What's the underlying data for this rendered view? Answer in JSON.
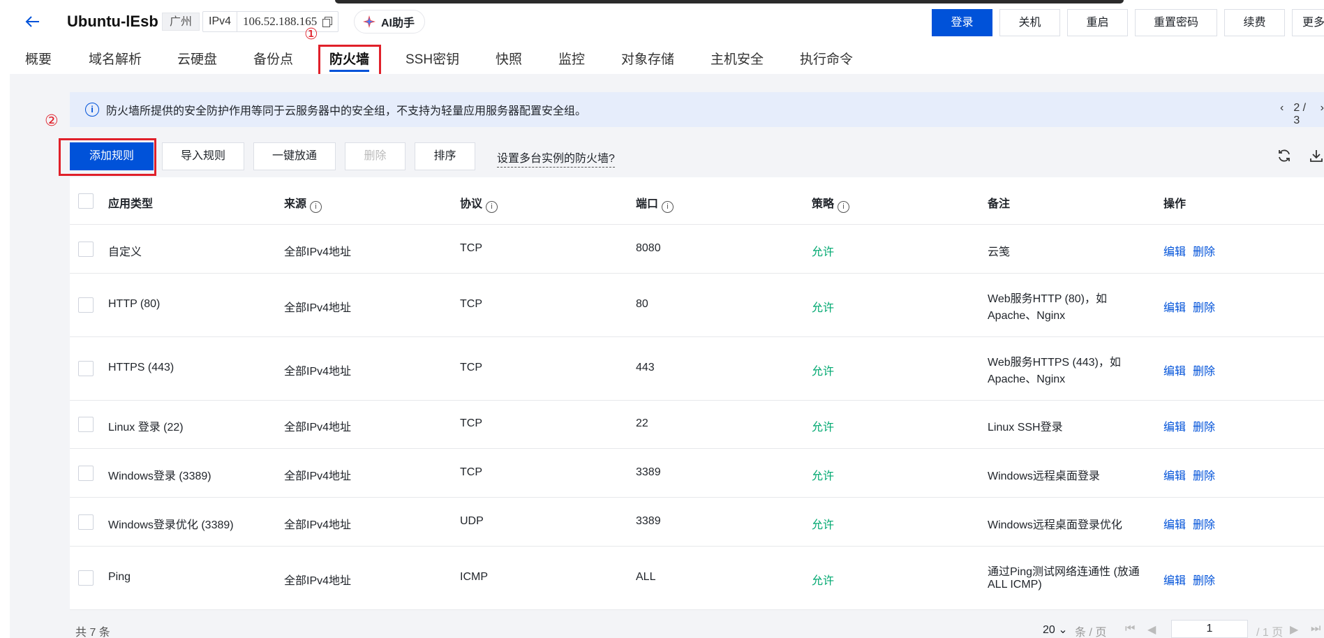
{
  "header": {
    "instance_name": "Ubuntu-lEsb",
    "region": "广州",
    "ip_label": "IPv4",
    "ip_value": "106.52.188.165",
    "ai_label": "AI助手",
    "actions": [
      "登录",
      "关机",
      "重启",
      "重置密码",
      "续费",
      "更多"
    ]
  },
  "annotations": {
    "mark1": "①",
    "mark2": "②"
  },
  "tabs": [
    "概要",
    "域名解析",
    "云硬盘",
    "备份点",
    "防火墙",
    "SSH密钥",
    "快照",
    "监控",
    "对象存储",
    "主机安全",
    "执行命令"
  ],
  "active_tab": "防火墙",
  "notice": {
    "text": "防火墙所提供的安全防护作用等同于云服务器中的安全组，不支持为轻量应用服务器配置安全组。",
    "pager": "2 / 3"
  },
  "toolbar": {
    "add": "添加规则",
    "import": "导入规则",
    "open_all": "一键放通",
    "delete": "删除",
    "sort": "排序",
    "multi_link": "设置多台实例的防火墙?"
  },
  "table": {
    "headers": [
      "应用类型",
      "来源",
      "协议",
      "端口",
      "策略",
      "备注",
      "操作"
    ],
    "rows": [
      {
        "type": "自定义",
        "source": "全部IPv4地址",
        "protocol": "TCP",
        "port": "8080",
        "policy": "允许",
        "note1": "云笺",
        "note2": ""
      },
      {
        "type": "HTTP (80)",
        "source": "全部IPv4地址",
        "protocol": "TCP",
        "port": "80",
        "policy": "允许",
        "note1": "Web服务HTTP (80)，如",
        "note2": "Apache、Nginx"
      },
      {
        "type": "HTTPS (443)",
        "source": "全部IPv4地址",
        "protocol": "TCP",
        "port": "443",
        "policy": "允许",
        "note1": "Web服务HTTPS (443)，如",
        "note2": "Apache、Nginx"
      },
      {
        "type": "Linux 登录 (22)",
        "source": "全部IPv4地址",
        "protocol": "TCP",
        "port": "22",
        "policy": "允许",
        "note1": "Linux SSH登录",
        "note2": ""
      },
      {
        "type": "Windows登录 (3389)",
        "source": "全部IPv4地址",
        "protocol": "TCP",
        "port": "3389",
        "policy": "允许",
        "note1": "Windows远程桌面登录",
        "note2": ""
      },
      {
        "type": "Windows登录优化 (3389)",
        "source": "全部IPv4地址",
        "protocol": "UDP",
        "port": "3389",
        "policy": "允许",
        "note1": "Windows远程桌面登录优化",
        "note2": ""
      },
      {
        "type": "Ping",
        "source": "全部IPv4地址",
        "protocol": "ICMP",
        "port": "ALL",
        "policy": "允许",
        "note1": "通过Ping测试网络连通性 (放通",
        "note2": "ALL ICMP)"
      }
    ],
    "edit": "编辑",
    "delete": "删除"
  },
  "footer": {
    "total": "共 7 条",
    "page_size": "20",
    "per_page": "条 / 页",
    "page": "1",
    "total_pages": "/ 1 页"
  },
  "colors": {
    "primary": "#0052d9",
    "allow": "#00a870",
    "highlight": "#e0202a"
  }
}
